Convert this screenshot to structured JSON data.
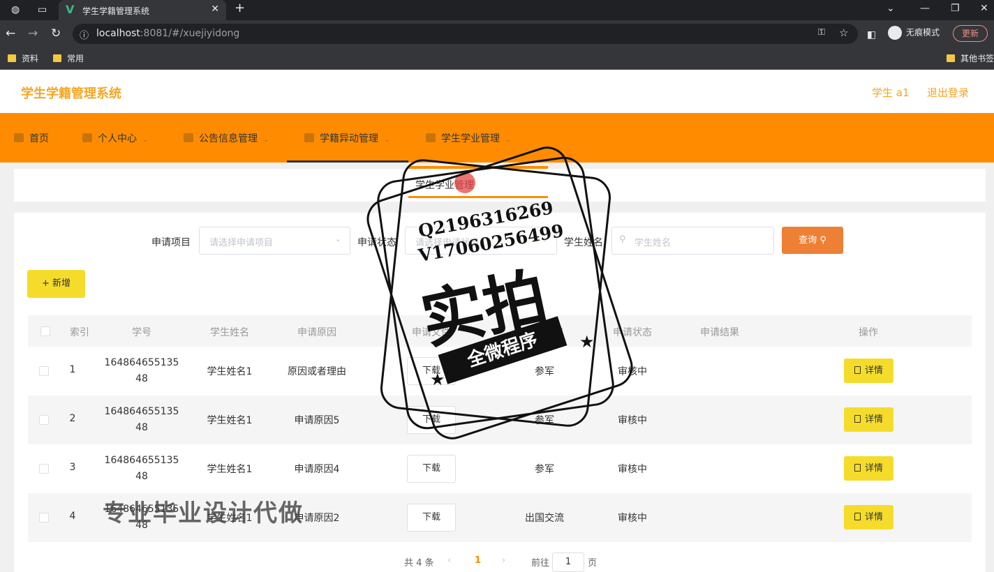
{
  "browser": {
    "tab_title": "学生学籍管理系统",
    "url_host": "localhost",
    "url_rest": ":8081/#/xuejiyidong",
    "incognito_label": "无痕模式",
    "update_label": "更新",
    "bookmarks": [
      "资料",
      "常用"
    ],
    "other_bookmarks": "其他书签"
  },
  "header": {
    "title": "学生学籍管理系统",
    "user": "学生 a1",
    "logout": "退出登录"
  },
  "nav": {
    "items": [
      {
        "label": "首页",
        "icon": "home-icon"
      },
      {
        "label": "个人中心",
        "icon": "user-icon"
      },
      {
        "label": "公告信息管理",
        "icon": "notice-icon"
      },
      {
        "label": "学籍异动管理",
        "icon": "file-icon"
      },
      {
        "label": "学生学业管理",
        "icon": "chart-icon"
      }
    ],
    "submenu_item": "学生学业管理"
  },
  "filters": {
    "project_label": "申请项目",
    "project_placeholder": "请选择申请项目",
    "status_label": "申请状态",
    "status_placeholder": "请选择申请状态",
    "name_label": "学生姓名",
    "name_placeholder": "学生姓名",
    "search_button": "查询"
  },
  "add_button": "+ 新增",
  "table": {
    "headers": [
      "索引",
      "学号",
      "学生姓名",
      "申请原因",
      "申请文件",
      "申请项目",
      "申请状态",
      "申请结果",
      "操作"
    ],
    "download_label": "下载",
    "detail_label": "详情",
    "rows": [
      {
        "index": "1",
        "student_id": "16486465513548",
        "name": "学生姓名1",
        "reason": "原因或者理由",
        "project": "参军",
        "status": "审核中",
        "result": ""
      },
      {
        "index": "2",
        "student_id": "16486465513548",
        "name": "学生姓名1",
        "reason": "申请原因5",
        "project": "参军",
        "status": "审核中",
        "result": ""
      },
      {
        "index": "3",
        "student_id": "16486465513548",
        "name": "学生姓名1",
        "reason": "申请原因4",
        "project": "参军",
        "status": "审核中",
        "result": ""
      },
      {
        "index": "4",
        "student_id": "16486465513548",
        "name": "学生姓名1",
        "reason": "申请原因2",
        "project": "出国交流",
        "status": "审核中",
        "result": ""
      }
    ]
  },
  "pagination": {
    "total": "共 4 条",
    "current": "1",
    "goto_label": "前往",
    "goto_value": "1",
    "page_suffix": "页"
  },
  "watermark": {
    "qq": "Q2196316269",
    "vx": "V17060256499",
    "big": "实拍",
    "ribbon": "全微程序",
    "promo": "专业毕业设计代做"
  }
}
